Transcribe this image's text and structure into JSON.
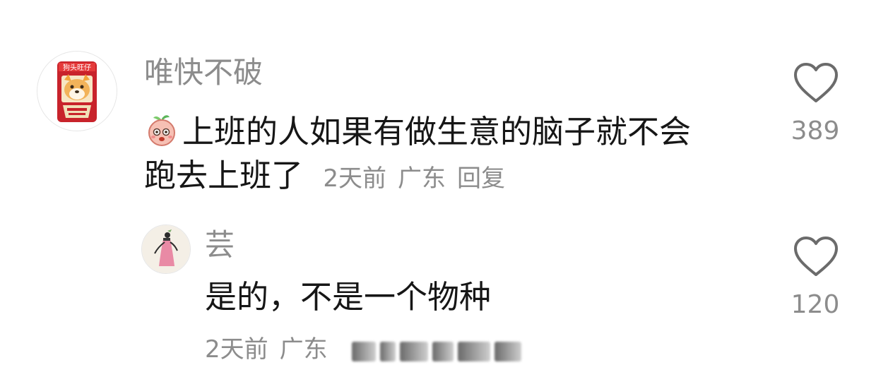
{
  "comment": {
    "username": "唯快不破",
    "text_line1": "上班的人如果有做生意的脑子就不会",
    "text_line2": "跑去上班了",
    "time": "2天前",
    "location": "广东",
    "reply_label": "回复",
    "like_count": "389",
    "avatar_logo_text": "狗头旺仔",
    "emoji_icon": "peach-emoji-icon"
  },
  "reply": {
    "username": "芸",
    "text": "是的，不是一个物种",
    "time": "2天前",
    "location": "广东",
    "like_count": "120"
  },
  "colors": {
    "username": "#8c8c8c",
    "text": "#161616",
    "meta": "#8c8c8c",
    "heart_stroke": "#6b6b6b"
  }
}
